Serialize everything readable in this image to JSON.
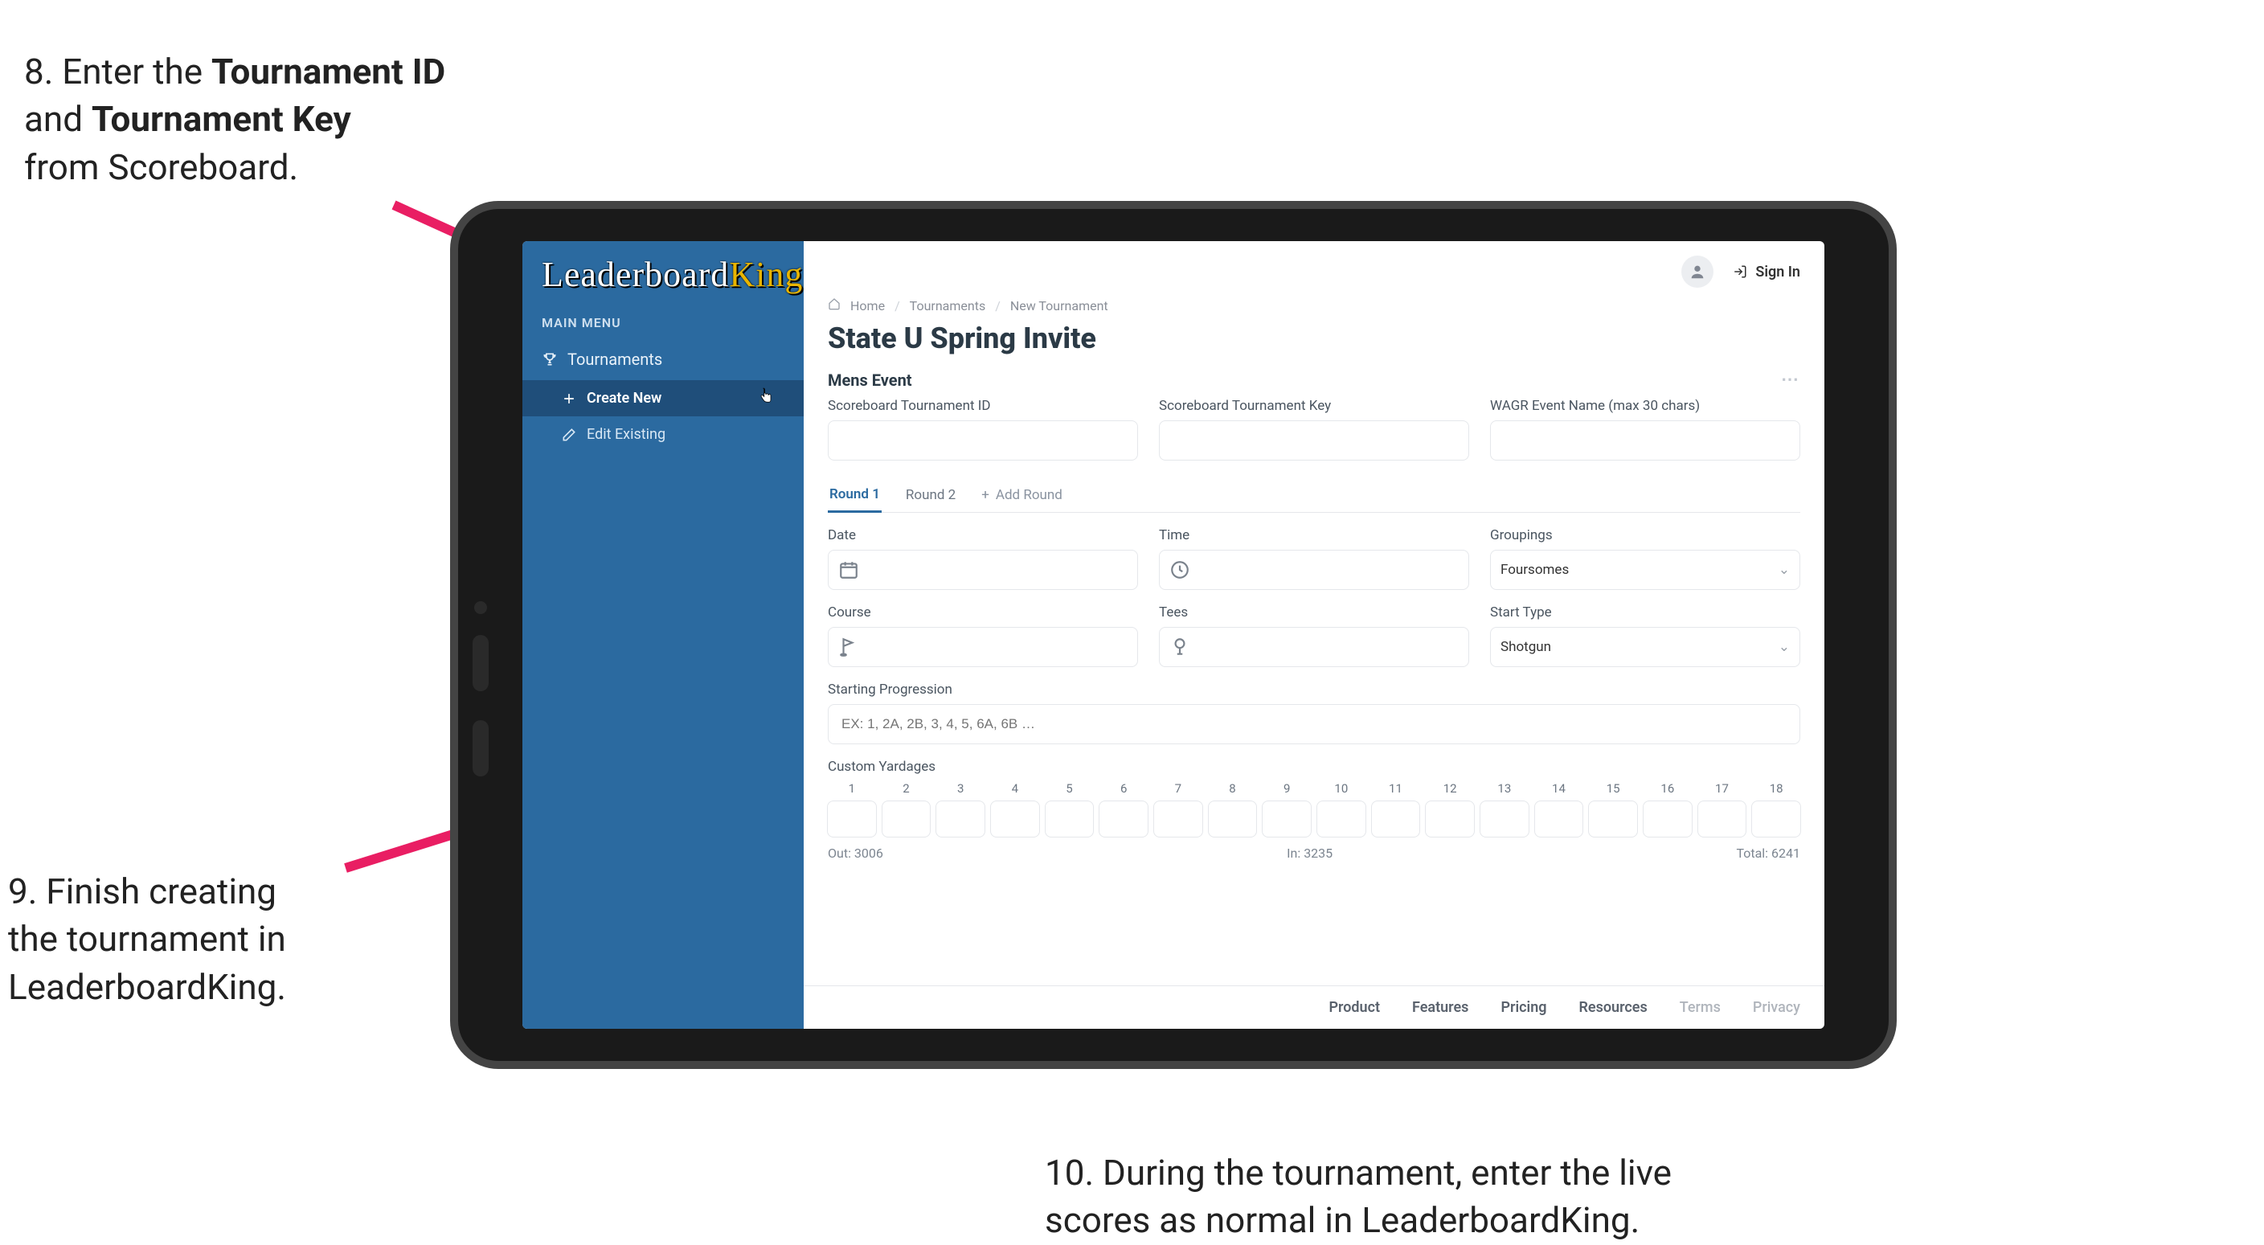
{
  "annotations": {
    "step8_pre": "8. Enter the ",
    "step8_b1": "Tournament ID",
    "step8_mid": "and ",
    "step8_b2": "Tournament Key",
    "step8_post": "from Scoreboard.",
    "step9_l1": "9. Finish creating",
    "step9_l2": "the tournament in",
    "step9_l3": "LeaderboardKing.",
    "step10_l1": "10. During the tournament, enter the live",
    "step10_l2": "scores as normal in LeaderboardKing."
  },
  "colors": {
    "arrow": "#e91e63"
  },
  "sidebar": {
    "logo_part1": "Leaderboard",
    "logo_part2": "King",
    "menu_title": "MAIN MENU",
    "tournaments_label": "Tournaments",
    "create_new_label": "Create New",
    "edit_existing_label": "Edit Existing"
  },
  "topbar": {
    "sign_in": "Sign In"
  },
  "breadcrumbs": {
    "home": "Home",
    "tournaments": "Tournaments",
    "new": "New Tournament"
  },
  "page": {
    "title": "State U Spring Invite"
  },
  "section": {
    "mens_event": "Mens Event"
  },
  "labels": {
    "sb_id": "Scoreboard Tournament ID",
    "sb_key": "Scoreboard Tournament Key",
    "wagr": "WAGR Event Name (max 30 chars)",
    "date": "Date",
    "time": "Time",
    "groupings": "Groupings",
    "course": "Course",
    "tees": "Tees",
    "start_type": "Start Type",
    "start_prog": "Starting Progression",
    "start_prog_ph": "EX: 1, 2A, 2B, 3, 4, 5, 6A, 6B …",
    "custom_yard": "Custom Yardages"
  },
  "tabs": {
    "r1": "Round 1",
    "r2": "Round 2",
    "add": "Add Round"
  },
  "selects": {
    "groupings": "Foursomes",
    "start_type": "Shotgun"
  },
  "holes": [
    "1",
    "2",
    "3",
    "4",
    "5",
    "6",
    "7",
    "8",
    "9",
    "10",
    "11",
    "12",
    "13",
    "14",
    "15",
    "16",
    "17",
    "18"
  ],
  "yardage": {
    "out_label": "Out:",
    "out": "3006",
    "in_label": "In:",
    "in": "3235",
    "total_label": "Total:",
    "total": "6241"
  },
  "footer": {
    "product": "Product",
    "features": "Features",
    "pricing": "Pricing",
    "resources": "Resources",
    "terms": "Terms",
    "privacy": "Privacy"
  }
}
